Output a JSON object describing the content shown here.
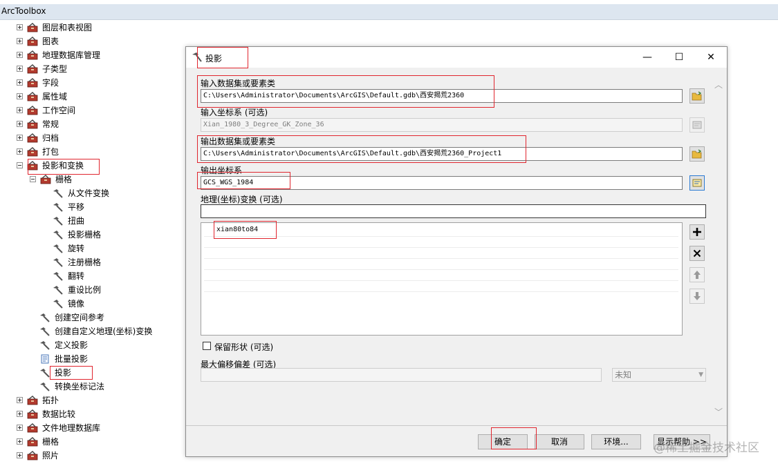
{
  "window_title": "ArcToolbox",
  "tree": {
    "items": [
      {
        "label": "图层和表视图",
        "kind": "toolbox",
        "expander": "plus"
      },
      {
        "label": "图表",
        "kind": "toolbox",
        "expander": "plus"
      },
      {
        "label": "地理数据库管理",
        "kind": "toolbox",
        "expander": "plus"
      },
      {
        "label": "子类型",
        "kind": "toolbox",
        "expander": "plus"
      },
      {
        "label": "字段",
        "kind": "toolbox",
        "expander": "plus"
      },
      {
        "label": "属性域",
        "kind": "toolbox",
        "expander": "plus"
      },
      {
        "label": "工作空间",
        "kind": "toolbox",
        "expander": "plus"
      },
      {
        "label": "常规",
        "kind": "toolbox",
        "expander": "plus"
      },
      {
        "label": "归档",
        "kind": "toolbox",
        "expander": "plus"
      },
      {
        "label": "打包",
        "kind": "toolbox",
        "expander": "plus"
      },
      {
        "label": "投影和变换",
        "kind": "toolbox",
        "expander": "minus"
      },
      {
        "label": "栅格",
        "kind": "toolbox",
        "expander": "minus"
      },
      {
        "label": "从文件变换",
        "kind": "tool"
      },
      {
        "label": "平移",
        "kind": "tool"
      },
      {
        "label": "扭曲",
        "kind": "tool"
      },
      {
        "label": "投影栅格",
        "kind": "tool"
      },
      {
        "label": "旋转",
        "kind": "tool"
      },
      {
        "label": "注册栅格",
        "kind": "tool"
      },
      {
        "label": "翻转",
        "kind": "tool"
      },
      {
        "label": "重设比例",
        "kind": "tool"
      },
      {
        "label": "镜像",
        "kind": "tool"
      },
      {
        "label": "创建空间参考",
        "kind": "tool"
      },
      {
        "label": "创建自定义地理(坐标)变换",
        "kind": "tool"
      },
      {
        "label": "定义投影",
        "kind": "tool"
      },
      {
        "label": "批量投影",
        "kind": "script"
      },
      {
        "label": "投影",
        "kind": "tool"
      },
      {
        "label": "转换坐标记法",
        "kind": "tool"
      },
      {
        "label": "拓扑",
        "kind": "toolbox",
        "expander": "plus"
      },
      {
        "label": "数据比较",
        "kind": "toolbox",
        "expander": "plus"
      },
      {
        "label": "文件地理数据库",
        "kind": "toolbox",
        "expander": "plus"
      },
      {
        "label": "栅格",
        "kind": "toolbox",
        "expander": "plus"
      },
      {
        "label": "照片",
        "kind": "toolbox",
        "expander": "plus"
      }
    ]
  },
  "dialog": {
    "title": "投影",
    "minimize_glyph": "—",
    "maximize_glyph": "☐",
    "close_glyph": "✕",
    "input_dataset_label": "输入数据集或要素类",
    "input_dataset_value": "C:\\Users\\Administrator\\Documents\\ArcGIS\\Default.gdb\\西安揭荒2360",
    "input_cs_label": "输入坐标系 (可选)",
    "input_cs_value": "Xian_1980_3_Degree_GK_Zone_36",
    "output_dataset_label": "输出数据集或要素类",
    "output_dataset_value": "C:\\Users\\Administrator\\Documents\\ArcGIS\\Default.gdb\\西安揭荒2360_Project1",
    "output_cs_label": "输出坐标系",
    "output_cs_value": "GCS_WGS_1984",
    "geo_transform_label": "地理(坐标)变换 (可选)",
    "geo_transform_value": "",
    "transform_list": [
      "xian80to84"
    ],
    "preserve_shape_label": "保留形状 (可选)",
    "max_offset_label": "最大偏移偏差 (可选)",
    "max_offset_unit": "未知",
    "buttons": {
      "ok": "确定",
      "cancel": "取消",
      "environments": "环境...",
      "show_help": "显示帮助 >>"
    }
  },
  "watermark": "@稀土掘金技术社区",
  "accent_color": "#e0242d",
  "icons": {
    "toolbox": "toolbox-icon",
    "tool": "hammer-icon",
    "script": "script-icon",
    "folder": "open-folder-icon",
    "spatial_reference": "spatial-reference-icon",
    "add": "plus-icon",
    "remove": "x-icon",
    "up": "arrow-up-icon",
    "down": "arrow-down-icon"
  }
}
